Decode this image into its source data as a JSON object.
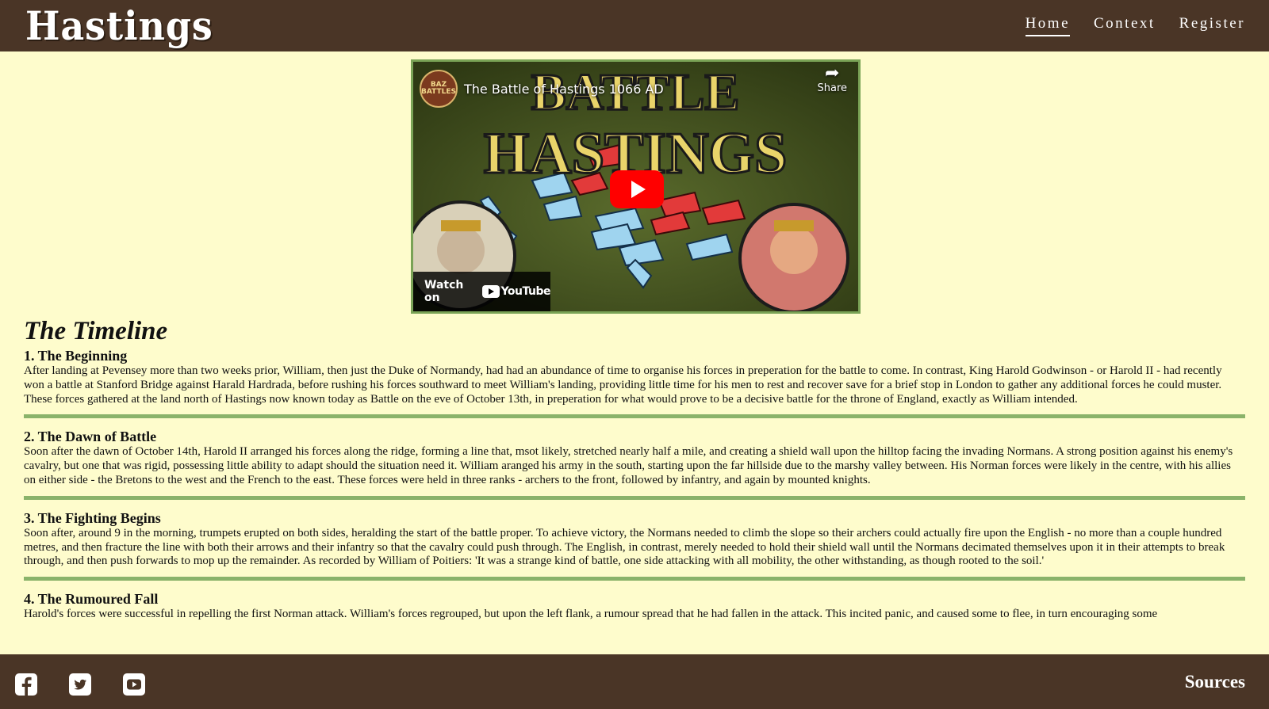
{
  "header": {
    "logo": "Hastings",
    "nav": [
      {
        "label": "Home",
        "active": true
      },
      {
        "label": "Context",
        "active": false
      },
      {
        "label": "Register",
        "active": false
      }
    ]
  },
  "video": {
    "channel_badge": "BAZ BATTLES",
    "title": "The Battle of Hastings 1066 AD",
    "share_label": "Share",
    "thumbnail_text_1": "BATTLE",
    "thumbnail_text_2": "HASTINGS",
    "watch_on_label": "Watch on",
    "youtube_label": "YouTube",
    "icons": {
      "play": "play-icon",
      "share": "share-icon"
    }
  },
  "timeline": {
    "title": "The Timeline",
    "sections": [
      {
        "heading": "1. The Beginning",
        "body": "After landing at Pevensey more than two weeks prior, William, then just the Duke of Normandy, had had an abundance of time to organise his forces in preperation for the battle to come. In contrast, King Harold Godwinson - or Harold II - had recently won a battle at Stanford Bridge against Harald Hardrada, before rushing his forces southward to meet William's landing, providing little time for his men to rest and recover save for a brief stop in London to gather any additional forces he could muster. These forces gathered at the land north of Hastings now known today as Battle on the eve of October 13th, in preperation for what would prove to be a decisive battle for the throne of England, exactly as William intended."
      },
      {
        "heading": "2. The Dawn of Battle",
        "body": "Soon after the dawn of October 14th, Harold II arranged his forces along the ridge, forming a line that, msot likely, stretched nearly half a mile, and creating a shield wall upon the hilltop facing the invading Normans. A strong position against his enemy's cavalry, but one that was rigid, possessing little ability to adapt should the situation need it. William aranged his army in the south, starting upon the far hillside due to the marshy valley between. His Norman forces were likely in the centre, with his allies on either side - the Bretons to the west and the French to the east. These forces were held in three ranks - archers to the front, followed by infantry, and again by mounted knights."
      },
      {
        "heading": "3. The Fighting Begins",
        "body": "Soon after, around 9 in the morning, trumpets erupted on both sides, heralding the start of the battle proper. To achieve victory, the Normans needed to climb the slope so their archers could actually fire upon the English - no more than a couple hundred metres, and then fracture the line with both their arrows and their infantry so that the cavalry could push through. The English, in contrast, merely needed to hold their shield wall until the Normans decimated themselves upon it in their attempts to break through, and then push forwards to mop up the remainder. As recorded by William of Poitiers: 'It was a strange kind of battle, one side attacking with all mobility, the other withstanding, as though rooted to the soil.'"
      },
      {
        "heading": "4. The Rumoured Fall",
        "body": "Harold's forces were successful in repelling the first Norman attack. William's forces regrouped, but upon the left flank, a rumour spread that he had fallen in the attack. This incited panic, and caused some to flee, in turn encouraging some"
      }
    ]
  },
  "footer": {
    "social_icons": [
      "facebook-icon",
      "twitter-icon",
      "youtube-icon"
    ],
    "sources_label": "Sources"
  },
  "colors": {
    "background": "#fefccc",
    "header_footer": "#4a3526",
    "divider": "#8ab36a",
    "video_border": "#7aa356",
    "play_red": "#ff0000"
  }
}
